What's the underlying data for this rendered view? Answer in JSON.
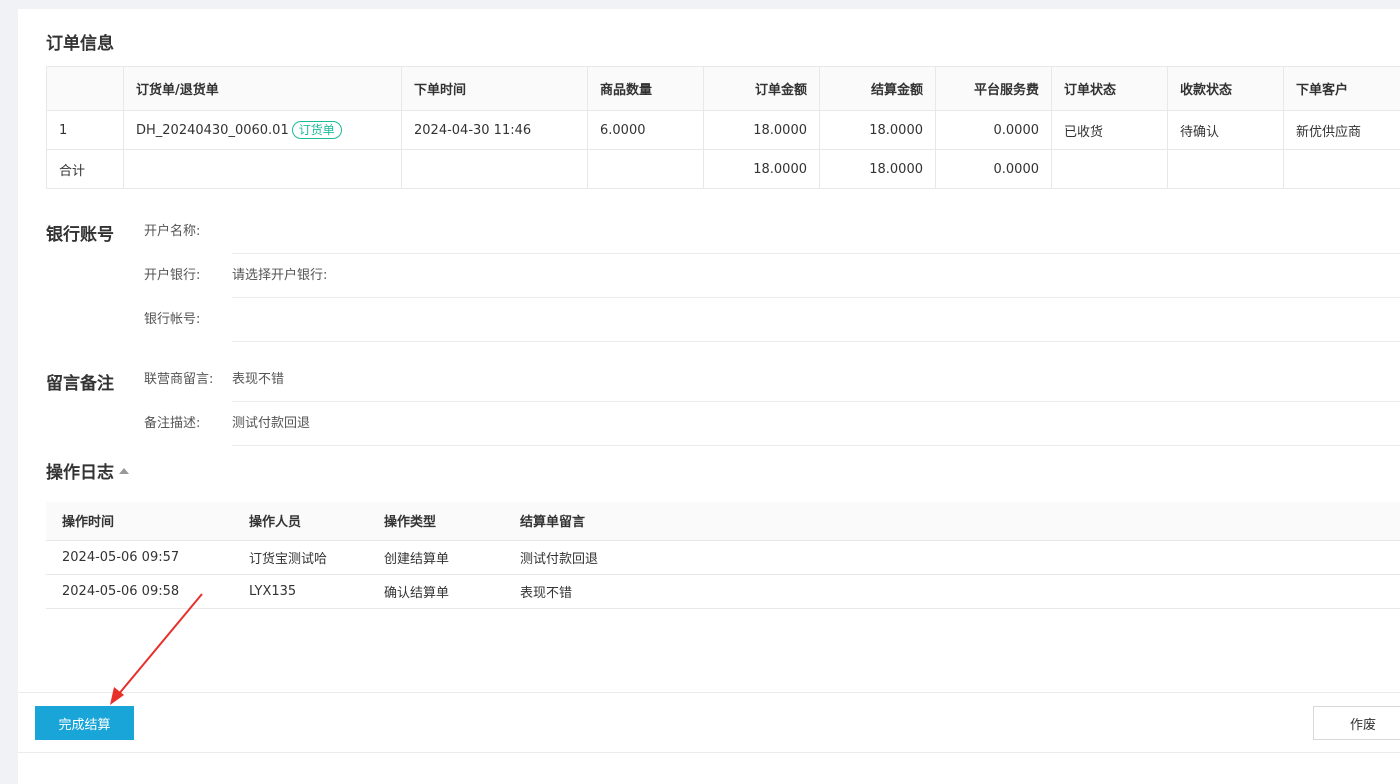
{
  "order_info": {
    "title": "订单信息",
    "columns": [
      "",
      "订货单/退货单",
      "下单时间",
      "商品数量",
      "订单金额",
      "结算金额",
      "平台服务费",
      "订单状态",
      "收款状态",
      "下单客户"
    ],
    "rows": [
      {
        "index": "1",
        "order_no": "DH_20240430_0060.01",
        "tag": "订货单",
        "time": "2024-04-30 11:46",
        "qty": "6.0000",
        "order_amount": "18.0000",
        "settle_amount": "18.0000",
        "service_fee": "0.0000",
        "order_status": "已收货",
        "payment_status": "待确认",
        "customer": "新优供应商"
      }
    ],
    "total": {
      "label": "合计",
      "order_amount": "18.0000",
      "settle_amount": "18.0000",
      "service_fee": "0.0000"
    }
  },
  "bank": {
    "title": "银行账号",
    "account_name_label": "开户名称:",
    "account_name_value": "",
    "bank_label": "开户银行:",
    "bank_value": "请选择开户银行:",
    "account_no_label": "银行帐号:",
    "account_no_value": ""
  },
  "remarks": {
    "title": "留言备注",
    "operator_msg_label": "联营商留言:",
    "operator_msg_value": "表现不错",
    "desc_label": "备注描述:",
    "desc_value": "测试付款回退"
  },
  "log": {
    "title": "操作日志",
    "columns": [
      "操作时间",
      "操作人员",
      "操作类型",
      "结算单留言"
    ],
    "rows": [
      {
        "time": "2024-05-06 09:57",
        "user": "订货宝测试哈",
        "type": "创建结算单",
        "msg": "测试付款回退"
      },
      {
        "time": "2024-05-06 09:58",
        "user": "LYX135",
        "type": "确认结算单",
        "msg": "表现不错"
      }
    ]
  },
  "actions": {
    "complete_label": "完成结算",
    "void_label": "作废"
  },
  "colors": {
    "primary": "#1aa5d9",
    "tag": "#1abc9c",
    "annotation_arrow": "#e8302a"
  }
}
